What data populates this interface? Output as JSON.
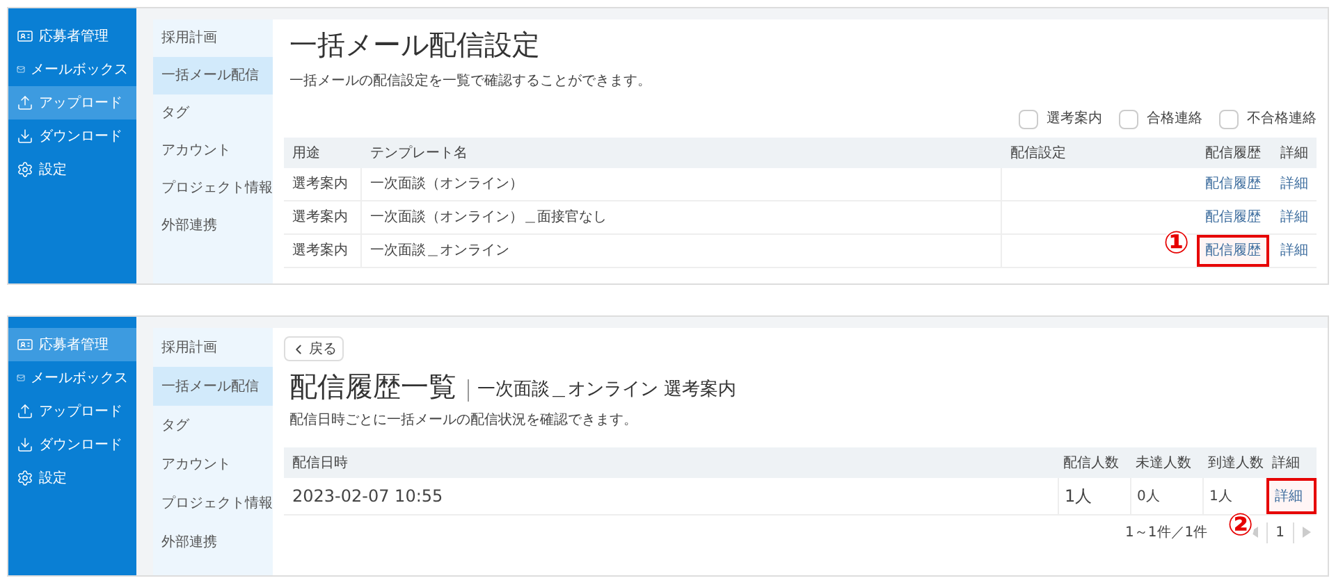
{
  "screens": [
    {
      "kind": "settings",
      "sidebar": {
        "items": [
          {
            "label": "応募者管理",
            "selected": false
          },
          {
            "label": "メールボックス",
            "selected": false
          },
          {
            "label": "アップロード",
            "selected": true
          },
          {
            "label": "ダウンロード",
            "selected": false
          },
          {
            "label": "設定",
            "selected": false
          }
        ]
      },
      "subnav": {
        "items": [
          {
            "label": "採用計画",
            "selected": false
          },
          {
            "label": "一括メール配信",
            "selected": true
          },
          {
            "label": "タグ",
            "selected": false
          },
          {
            "label": "アカウント",
            "selected": false
          },
          {
            "label": "プロジェクト情報",
            "selected": false
          },
          {
            "label": "外部連携",
            "selected": false
          }
        ]
      },
      "title": "一括メール配信設定",
      "description": "一括メールの配信設定を一覧で確認することができます。",
      "filters": [
        {
          "label": "選考案内",
          "checked": false
        },
        {
          "label": "合格連絡",
          "checked": false
        },
        {
          "label": "不合格連絡",
          "checked": false
        }
      ],
      "table": {
        "columns": [
          "用途",
          "テンプレート名",
          "配信設定",
          "配信履歴",
          "詳細"
        ],
        "rows": [
          {
            "cells": [
              "選考案内",
              "一次面談（オンライン）"
            ],
            "history_link": "配信履歴",
            "detail_link": "詳細",
            "highlighted": false
          },
          {
            "cells": [
              "選考案内",
              "一次面談（オンライン）＿面接官なし"
            ],
            "history_link": "配信履歴",
            "detail_link": "詳細",
            "highlighted": false
          },
          {
            "cells": [
              "選考案内",
              "一次面談＿オンライン"
            ],
            "history_link": "配信履歴",
            "detail_link": "詳細",
            "highlighted": true,
            "marker": "①"
          }
        ]
      }
    },
    {
      "kind": "history",
      "sidebar": {
        "items": [
          {
            "label": "応募者管理",
            "selected": true
          },
          {
            "label": "メールボックス",
            "selected": false
          },
          {
            "label": "アップロード",
            "selected": false
          },
          {
            "label": "ダウンロード",
            "selected": false
          },
          {
            "label": "設定",
            "selected": false
          }
        ]
      },
      "subnav": {
        "items": [
          {
            "label": "採用計画",
            "selected": false
          },
          {
            "label": "一括メール配信",
            "selected": true
          },
          {
            "label": "タグ",
            "selected": false
          },
          {
            "label": "アカウント",
            "selected": false
          },
          {
            "label": "プロジェクト情報",
            "selected": false
          },
          {
            "label": "外部連携",
            "selected": false
          }
        ]
      },
      "back_button": "戻る",
      "title": "配信履歴一覧",
      "subtitle": "一次面談＿オンライン 選考案内",
      "description": "配信日時ごとに一括メールの配信状況を確認できます。",
      "table": {
        "columns": [
          "配信日時",
          "配信人数",
          "未達人数",
          "到達人数",
          "詳細"
        ],
        "rows": [
          {
            "cells": [
              "2023-02-07 10:55",
              "1人",
              "0人",
              "1人"
            ],
            "detail_link": "詳細",
            "highlighted": true,
            "marker": "②"
          }
        ]
      },
      "pagination": {
        "summary": "1～1件／1件",
        "page": "1"
      }
    }
  ]
}
